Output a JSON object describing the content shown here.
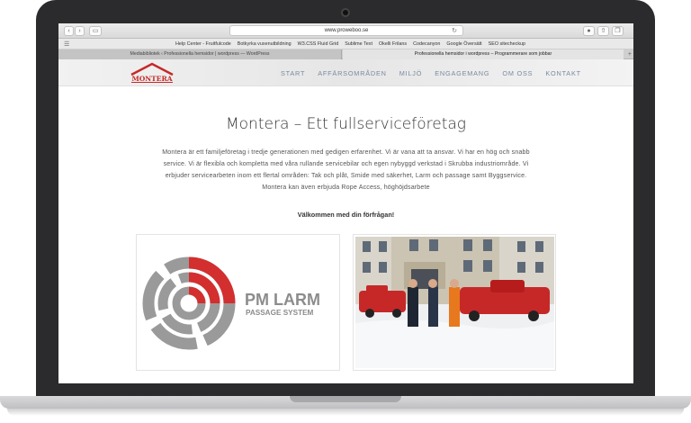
{
  "browser": {
    "url": "www.proweboo.se",
    "bookmarks": [
      "Help Center - Fruitfulcode",
      "Botkyrka vuxenutbildning",
      "W3.CSS Fluid Grid",
      "Sublime Text",
      "Okelli Frilans",
      "Codecanyon",
      "Google Översätt",
      "SEO sitecheckup"
    ],
    "tabs": [
      "Mediabibliotek ‹ Professionella hemsidor | wordpress — WordPress",
      "Professionella hemsidor i wordpress – Programmerare som jobbar"
    ]
  },
  "site": {
    "logo_text": "MONTERA",
    "nav": [
      "START",
      "AFFÄRSOMRÅDEN",
      "MILJÖ",
      "ENGAGEMANG",
      "OM OSS",
      "KONTAKT"
    ],
    "title": "Montera – Ett fullserviceföretag",
    "intro_lines": [
      "Montera är ett familjeföretag i tredje generationen med gedigen erfarenhet. Vi är vana att ta ansvar. Vi har en hög och snabb",
      "service. Vi är flexibla och kompletta med våra rullande servicebilar och egen nybyggd verkstad i Skrubba industriområde. Vi",
      "erbjuder servicearbeten inom ett flertal områden: Tak och plåt, Smide med säkerhet, Larm och passage samt Byggservice.",
      "Montera kan även erbjuda Rope Access, höghöjdsarbete"
    ],
    "welcome": "Välkommen med din förfrågan!",
    "partner_logo": {
      "name": "PM LARM",
      "tagline": "PASSAGE SYSTEM"
    }
  },
  "colors": {
    "accent_red": "#d32f2f",
    "nav_text": "#7a8aa0",
    "logo_gray": "#8c8c8c"
  }
}
